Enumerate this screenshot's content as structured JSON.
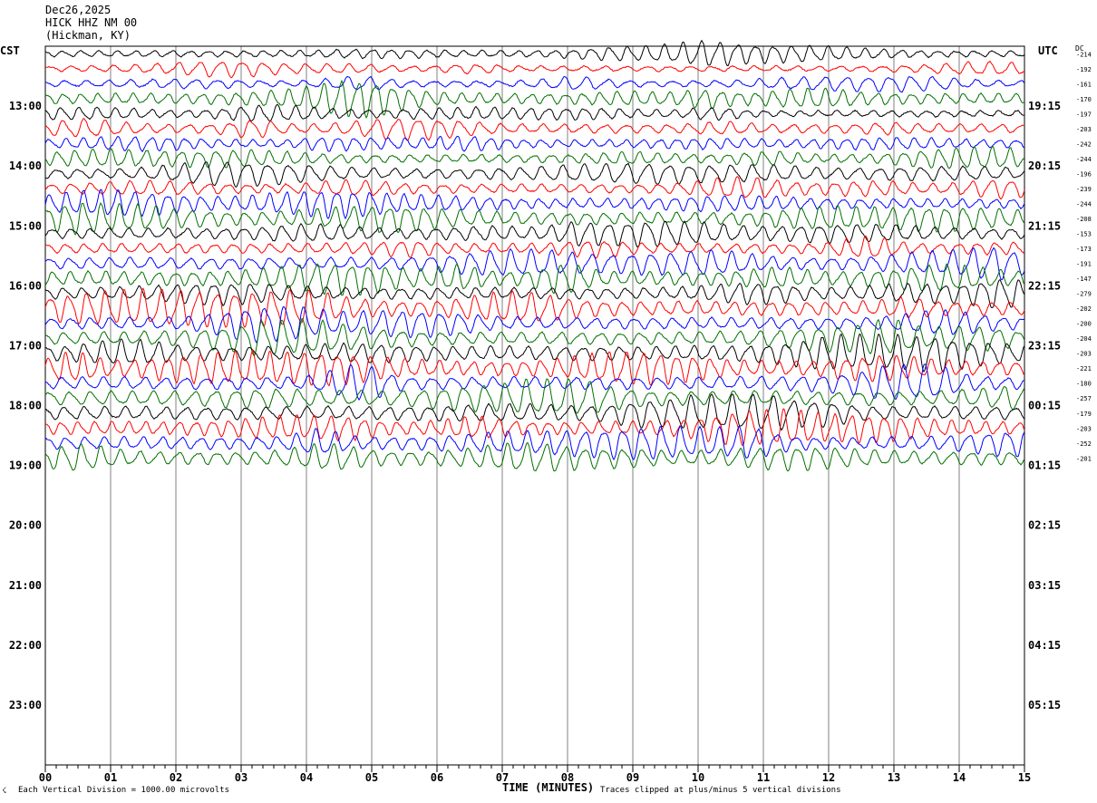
{
  "header": {
    "date": "Dec26,2025",
    "station": "HICK HHZ NM 00",
    "location": "(Hickman, KY)"
  },
  "left_zone": "CST",
  "right_zone": "UTC",
  "dc_label": "DC",
  "footer": {
    "scale_note": "Each Vertical Division = 1000.00 microvolts",
    "clip_note": "Traces clipped at plus/minus 5 vertical divisions",
    "corner_mark": "☇"
  },
  "colors": {
    "trace_cycle": [
      "#000000",
      "#ff0000",
      "#0000ff",
      "#007000"
    ],
    "grid": "#808080",
    "frame": "#000000"
  },
  "chart_data": {
    "type": "line",
    "title": "HICK HHZ NM 00",
    "xlabel": "TIME (MINUTES)",
    "ylabel": "",
    "x_ticks": [
      "00",
      "01",
      "02",
      "03",
      "04",
      "05",
      "06",
      "07",
      "08",
      "09",
      "10",
      "11",
      "12",
      "13",
      "14",
      "15"
    ],
    "xlim": [
      0,
      15
    ],
    "left_hour_labels": [
      "13:00",
      "14:00",
      "15:00",
      "16:00",
      "17:00",
      "18:00",
      "19:00",
      "20:00",
      "21:00",
      "22:00",
      "23:00"
    ],
    "right_hour_labels": [
      "19:15",
      "20:15",
      "21:15",
      "22:15",
      "23:15",
      "00:15",
      "01:15",
      "02:15",
      "03:15",
      "04:15",
      "05:15"
    ],
    "traces_per_hour": 4,
    "first_label_row": 4,
    "total_rows": 48,
    "traces_recorded": 28,
    "dc_offsets": [
      -214,
      -192,
      -161,
      -170,
      -197,
      -203,
      -242,
      -244,
      -196,
      -239,
      -244,
      -208,
      -153,
      -173,
      -191,
      -147,
      -279,
      -202,
      -200,
      -204,
      -203,
      -221,
      -180,
      -257,
      -179,
      -203,
      -252,
      -201
    ],
    "trace_amplitude_level": [
      0.35,
      0.3,
      0.35,
      0.6,
      0.35,
      0.5,
      0.45,
      0.45,
      0.55,
      0.5,
      0.55,
      0.7,
      0.6,
      0.55,
      0.65,
      0.8,
      0.65,
      0.8,
      0.65,
      0.7,
      0.8,
      0.8,
      0.7,
      0.8,
      0.75,
      0.75,
      0.7,
      0.75
    ],
    "grid": true
  }
}
